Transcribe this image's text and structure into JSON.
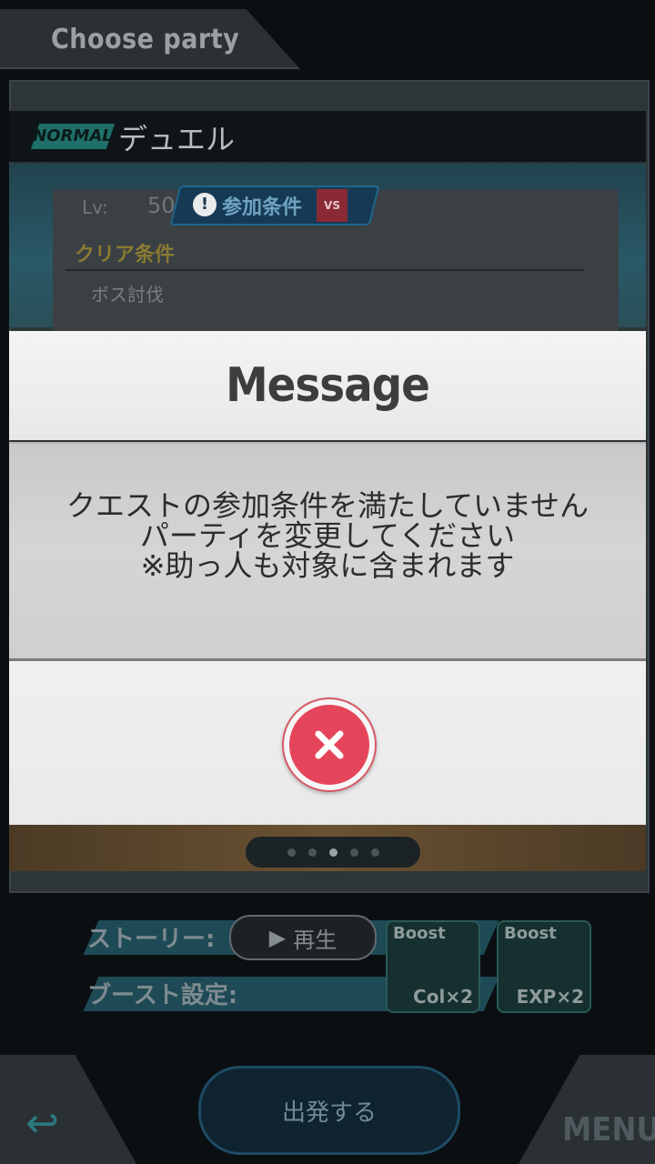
{
  "header": {
    "title": "Choose party"
  },
  "quest": {
    "difficulty": "NORMAL",
    "name": "デュエル",
    "lv_label": "Lv:",
    "lv_value": "50",
    "join_condition_label": "参加条件",
    "vs_badge": "VS",
    "clear_condition_title": "クリア条件",
    "clear_condition_item": "ボス討伐"
  },
  "dialog": {
    "title": "Message",
    "message_lines": [
      "クエストの参加条件を満たしていません",
      "パーティを変更してください",
      "※助っ人も対象に含まれます"
    ],
    "close_icon": "close-icon"
  },
  "footer": {
    "story_label": "ストーリー:",
    "play_label": "再生",
    "boost_label": "ブースト設定:",
    "boost_col": {
      "top": "Boost",
      "bottom": "Col×2"
    },
    "boost_exp": {
      "top": "Boost",
      "bottom": "EXP×2"
    },
    "depart_label": "出発する",
    "menu_label": "MENU"
  },
  "pager": {
    "count": 5,
    "active": 2
  },
  "colors": {
    "close_button": "#e5455a",
    "dialog_body": "#d0d0d0",
    "background": "#0b0f12"
  }
}
